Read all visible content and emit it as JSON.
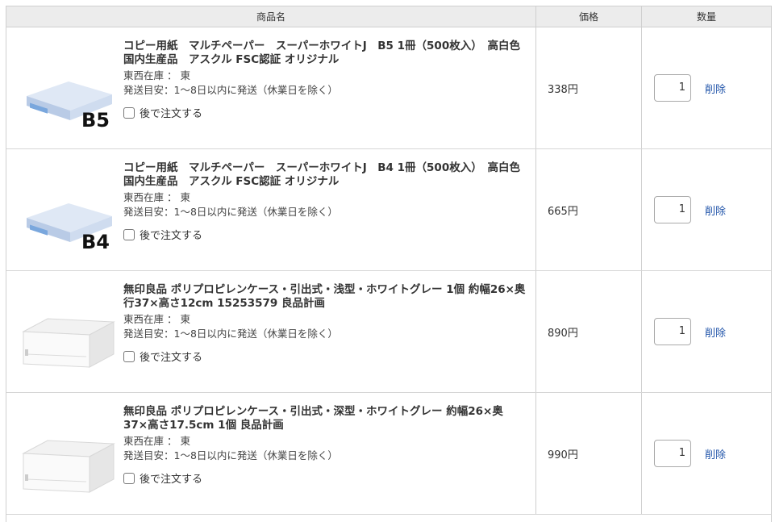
{
  "header": {
    "product": "商品名",
    "price": "価格",
    "qty": "数量"
  },
  "items": [
    {
      "name": "コピー用紙　マルチペーパー　スーパーホワイトJ　B5 1冊（500枚入）　高白色　国内生産品　アスクル FSC認証 オリジナル",
      "stock": "東西在庫 ： 東",
      "ship": "発送目安：1〜8日以内に発送（休業日を除く）",
      "later": "後で注文する",
      "price": "338円",
      "qty": "1",
      "remove": "削除",
      "badge": "B5",
      "kind": "paper"
    },
    {
      "name": "コピー用紙　マルチペーパー　スーパーホワイトJ　B4 1冊（500枚入）　高白色　国内生産品　アスクル FSC認証 オリジナル",
      "stock": "東西在庫 ： 東",
      "ship": "発送目安：1〜8日以内に発送（休業日を除く）",
      "later": "後で注文する",
      "price": "665円",
      "qty": "1",
      "remove": "削除",
      "badge": "B4",
      "kind": "paper"
    },
    {
      "name": "無印良品 ポリプロピレンケース・引出式・浅型・ホワイトグレー 1個 約幅26×奥行37×高さ12cm 15253579 良品計画",
      "stock": "東西在庫 ： 東",
      "ship": "発送目安：1〜8日以内に発送（休業日を除く）",
      "later": "後で注文する",
      "price": "890円",
      "qty": "1",
      "remove": "削除",
      "badge": "",
      "kind": "case"
    },
    {
      "name": "無印良品 ポリプロピレンケース・引出式・深型・ホワイトグレー 約幅26×奥37×高さ17.5cm 1個 良品計画",
      "stock": "東西在庫 ： 東",
      "ship": "発送目安：1〜8日以内に発送（休業日を除く）",
      "later": "後で注文する",
      "price": "990円",
      "qty": "1",
      "remove": "削除",
      "badge": "",
      "kind": "case"
    }
  ]
}
